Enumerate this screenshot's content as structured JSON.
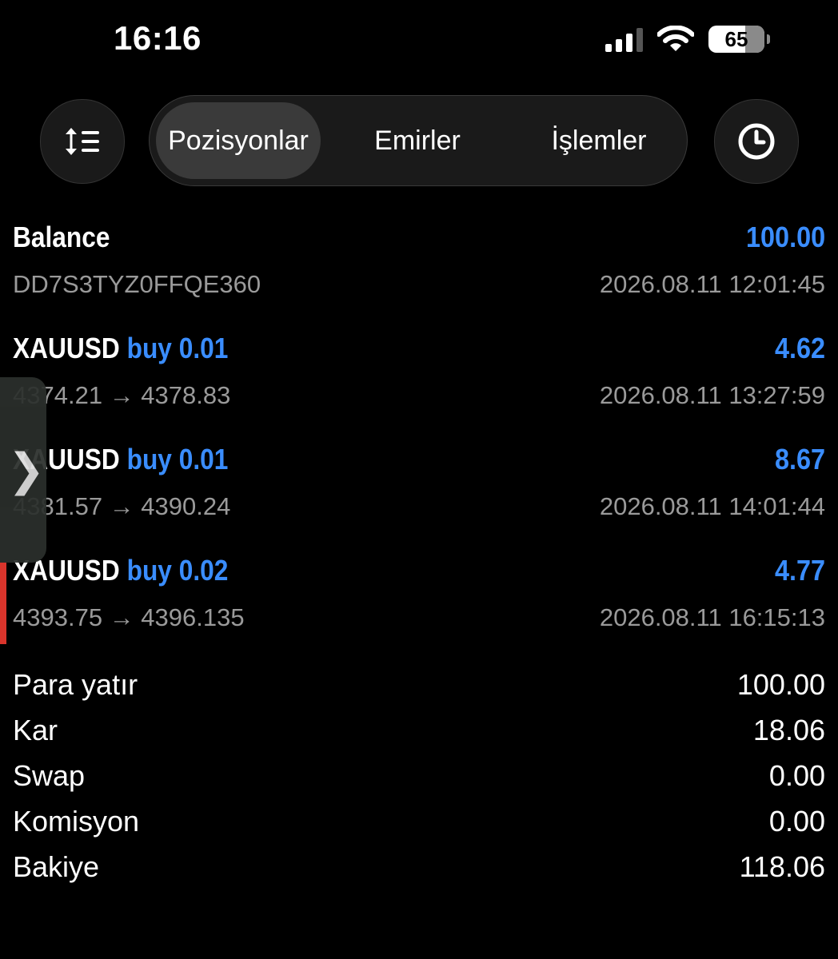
{
  "status_bar": {
    "time": "16:16",
    "battery": "65"
  },
  "tabs": [
    {
      "label": "Pozisyonlar",
      "active": true
    },
    {
      "label": "Emirler",
      "active": false
    },
    {
      "label": "İşlemler",
      "active": false
    }
  ],
  "icons": {
    "sort": "sort-list-icon",
    "history": "clock-icon",
    "side": "chevron-right-icon"
  },
  "colors": {
    "accent": "#3a8dff",
    "marker": "#d9342b",
    "background": "#000000"
  },
  "balance": {
    "label": "Balance",
    "value": "100.00",
    "id": "DD7S3TYZ0FFQE360",
    "time": "2026.08.11 12:01:45"
  },
  "deals": [
    {
      "symbol": "XAUUSD",
      "side": "buy 0.01",
      "profit": "4.62",
      "prices": "4374.21 → 4378.83",
      "time": "2026.08.11 13:27:59"
    },
    {
      "symbol": "XAUUSD",
      "side": "buy 0.01",
      "profit": "8.67",
      "prices": "4381.57 → 4390.24",
      "time": "2026.08.11 14:01:44"
    },
    {
      "symbol": "XAUUSD",
      "side": "buy 0.02",
      "profit": "4.77",
      "prices": "4393.75 → 4396.135",
      "time": "2026.08.11 16:15:13"
    }
  ],
  "summary": [
    {
      "label": "Para yatır",
      "value": "100.00"
    },
    {
      "label": "Kar",
      "value": "18.06"
    },
    {
      "label": "Swap",
      "value": "0.00"
    },
    {
      "label": "Komisyon",
      "value": "0.00"
    },
    {
      "label": "Bakiye",
      "value": "118.06"
    }
  ]
}
